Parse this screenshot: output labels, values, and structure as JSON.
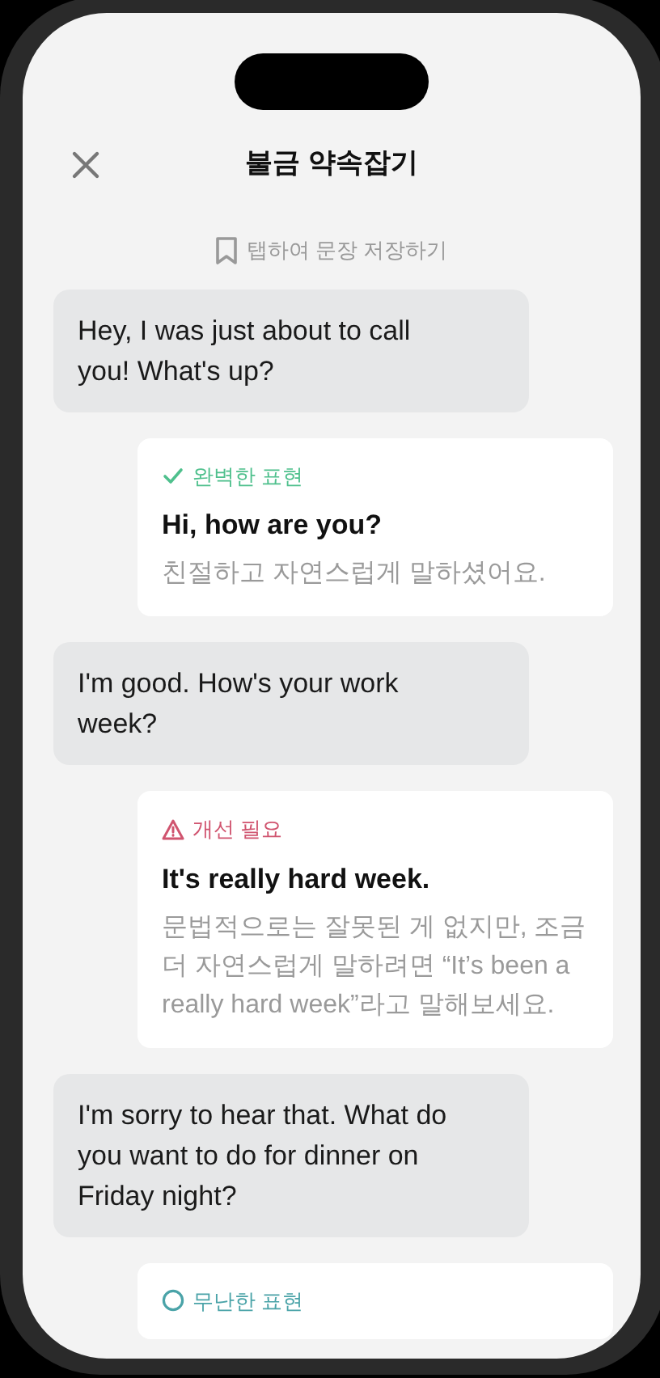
{
  "header": {
    "title": "불금 약속잡기"
  },
  "save_hint": "탭하여 문장 저장하기",
  "messages": [
    {
      "kind": "bubble",
      "text": "Hey, I was just about to call you! What's up?"
    },
    {
      "kind": "perfect",
      "label": "완벽한 표현",
      "sentence": "Hi, how are you?",
      "comment": "친절하고 자연스럽게 말하셨어요."
    },
    {
      "kind": "bubble",
      "text": "I'm good. How's your work week?"
    },
    {
      "kind": "improve",
      "label": "개선 필요",
      "sentence": "It's really hard week.",
      "comment": "문법적으로는 잘못된 게 없지만, 조금 더 자연스럽게 말하려면 “It’s been a really hard week”라고 말해보세요."
    },
    {
      "kind": "bubble",
      "text": "I'm sorry to hear that. What do you want to do for dinner on Friday night?"
    },
    {
      "kind": "okay",
      "label": "무난한 표현"
    }
  ]
}
